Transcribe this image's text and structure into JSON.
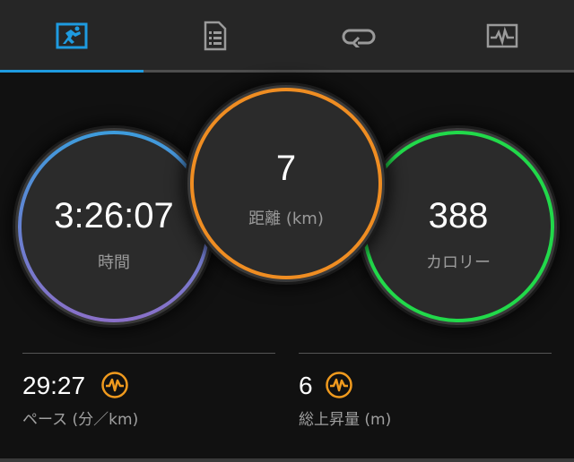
{
  "tabs": [
    {
      "name": "overview",
      "icon": "runner-icon",
      "active": true
    },
    {
      "name": "details",
      "icon": "document-list-icon",
      "active": false
    },
    {
      "name": "laps",
      "icon": "loop-icon",
      "active": false
    },
    {
      "name": "charts",
      "icon": "heart-chart-icon",
      "active": false
    }
  ],
  "circles": {
    "time": {
      "value": "3:26:07",
      "label": "時間"
    },
    "distance": {
      "value": "7",
      "label": "距離 (km)"
    },
    "calories": {
      "value": "388",
      "label": "カロリー"
    }
  },
  "stats": {
    "pace": {
      "value": "29:27",
      "label": "ペース (分／km)",
      "icon": "pulse-icon"
    },
    "elevation": {
      "value": "6",
      "label": "総上昇量 (m)",
      "icon": "pulse-icon"
    }
  },
  "colors": {
    "active_tab": "#1e9be0",
    "distance_ring": "#ef8d22",
    "calories_ring": "#21d94a",
    "time_ring_top": "#3d9cdc",
    "time_ring_bottom": "#8a70c8",
    "stat_icon": "#f09a1e"
  }
}
